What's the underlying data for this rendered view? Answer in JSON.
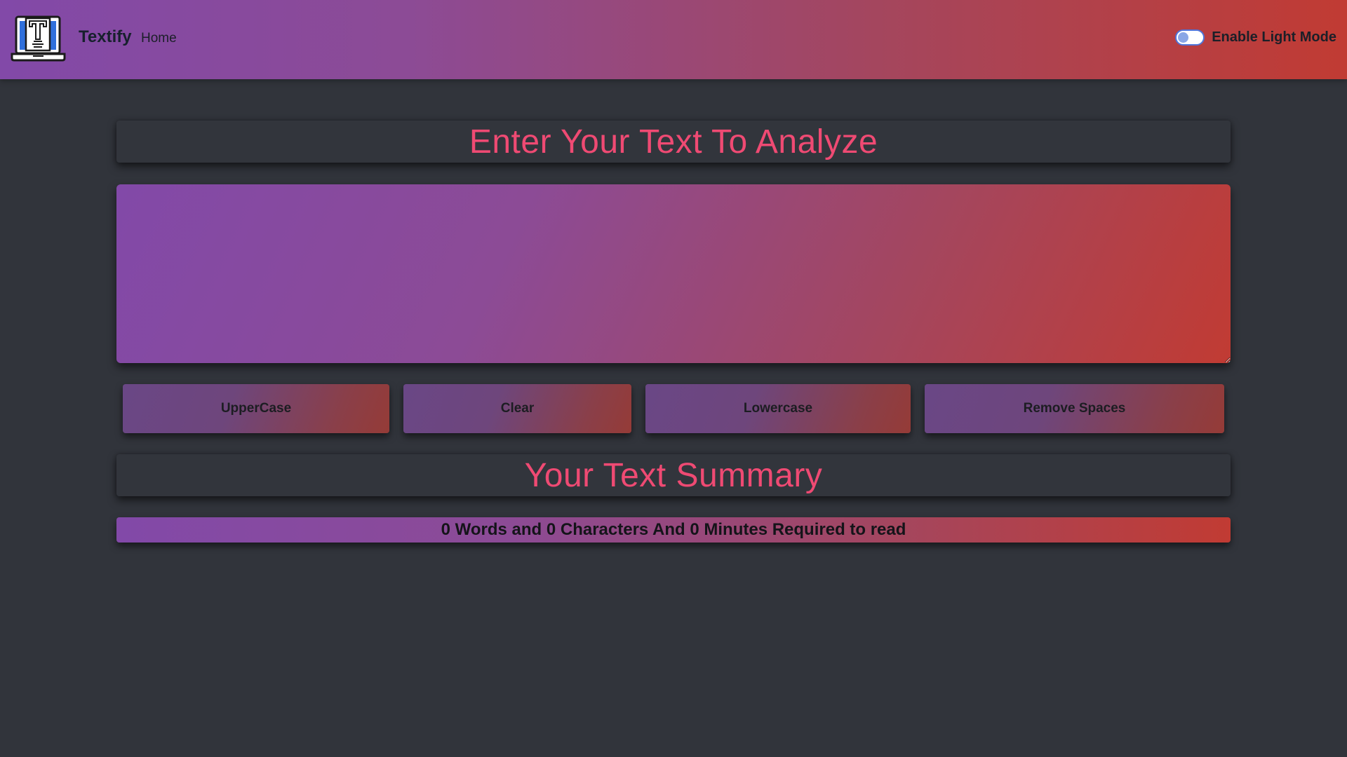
{
  "navbar": {
    "brand_name": "Textify",
    "logo_icon": "laptop-text-logo-icon",
    "nav_items": [
      {
        "label": "Home"
      }
    ],
    "mode_toggle": {
      "label": "Enable Light Mode",
      "checked": false
    }
  },
  "analyzer": {
    "heading": "Enter Your Text To Analyze",
    "textarea_value": "",
    "buttons": [
      {
        "label": "UpperCase"
      },
      {
        "label": "Clear"
      },
      {
        "label": "Lowercase"
      },
      {
        "label": "Remove Spaces"
      }
    ]
  },
  "summary": {
    "heading": "Your Text Summary",
    "stats_text": "0 Words and 0 Characters And 0 Minutes Required to read"
  },
  "colors": {
    "page_background": "#31343b",
    "gradient_start": "#8249a8",
    "gradient_end": "#c13b33",
    "heading_pink": "#ef4a73",
    "toggle_blue": "#4f74d9"
  }
}
